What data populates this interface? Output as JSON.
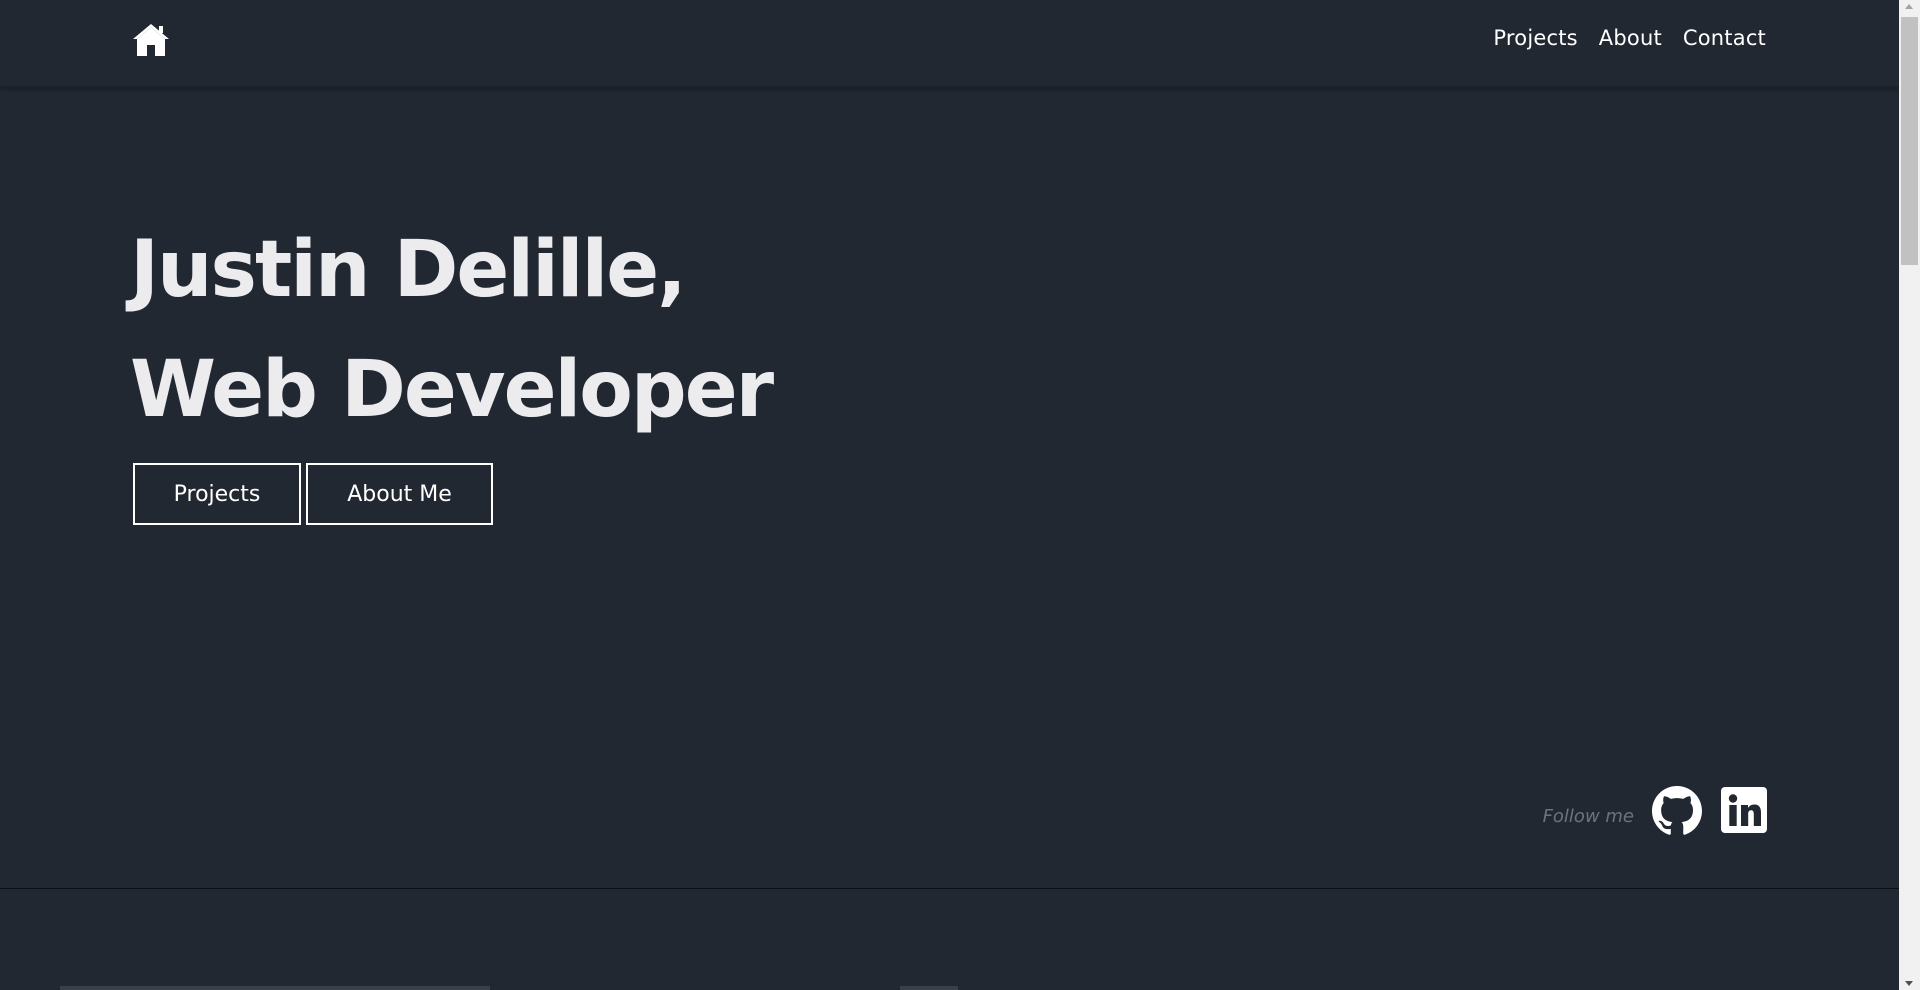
{
  "header": {
    "home_icon": "home-icon",
    "nav": [
      {
        "label": "Projects"
      },
      {
        "label": "About"
      },
      {
        "label": "Contact"
      }
    ]
  },
  "hero": {
    "title_line1": "Justin Delille,",
    "title_line2": "Web Developer",
    "buttons": {
      "projects_label": "Projects",
      "about_label": "About Me"
    }
  },
  "social": {
    "follow_label": "Follow me",
    "icons": [
      "github-icon",
      "linkedin-icon"
    ]
  },
  "colors": {
    "background": "#222832",
    "text": "#ffffff",
    "muted": "#6e737b"
  }
}
